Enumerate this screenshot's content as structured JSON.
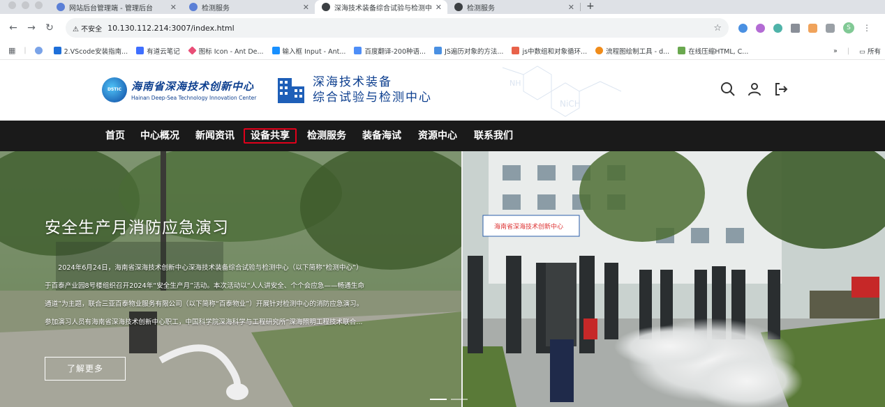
{
  "browser": {
    "tabs": [
      {
        "title": "网站后台管理端 - 管理后台",
        "active": false,
        "color": "#5b7fd6"
      },
      {
        "title": "检测服务",
        "active": false,
        "color": "#5b7fd6"
      },
      {
        "title": "深海技术装备综合试验与检测中",
        "active": true,
        "color": "#3c4043"
      },
      {
        "title": "检测服务",
        "active": false,
        "color": "#3c4043"
      }
    ],
    "close_glyph": "✕",
    "new_tab_glyph": "+",
    "security_label": "不安全",
    "url": "10.130.112.214:3007/index.html",
    "profile_initial": "S"
  },
  "bookmarks": {
    "items": [
      {
        "label": "2.VScode安装指南...",
        "color": "#1e6fd9"
      },
      {
        "label": "有道云笔记",
        "color": "#3f6fff"
      },
      {
        "label": "图标 Icon - Ant De...",
        "color": "#e94e77"
      },
      {
        "label": "输入框 Input - Ant...",
        "color": "#1890ff"
      },
      {
        "label": "百度翻译-200种语...",
        "color": "#4e8ef7"
      },
      {
        "label": "JS遍历对象的方法...",
        "color": "#4a90e2"
      },
      {
        "label": "js中数组和对象循环...",
        "color": "#e8624a"
      },
      {
        "label": "流程图绘制工具 - d...",
        "color": "#f08c1a"
      },
      {
        "label": "在线压缩HTML, C...",
        "color": "#6aa84f"
      }
    ],
    "overflow": "»",
    "all_label": "所有"
  },
  "site": {
    "logo_center_cn": "海南省深海技术创新中心",
    "logo_center_en": "Hainan Deep-Sea Technology Innovation Center",
    "logo_badge": "DSTIC",
    "logo2_line1": "深海技术装备",
    "logo2_line2": "综合试验与检测中心",
    "brand_color": "#0d3f8f"
  },
  "nav": {
    "items": [
      "首页",
      "中心概况",
      "新闻资讯",
      "设备共享",
      "检测服务",
      "装备海试",
      "资源中心",
      "联系我们"
    ],
    "highlighted_index": 3,
    "highlight_color": "#e0001a"
  },
  "hero": {
    "title": "安全生产月消防应急演习",
    "body_lines": [
      "　　2024年6月24日，海南省深海技术创新中心深海技术装备综合试验与检测中心（以下简称“检测中心”）",
      "于百泰产业园8号楼组织召开2024年“安全生产月”活动。本次活动以“人人讲安全、个个会应急——畅通生命",
      "通道”为主题，联合三亚百泰物业服务有限公司（以下简称“百泰物业”）开展针对检测中心的消防应急演习。",
      "参加演习人员有海南省深海技术创新中心职工，中国科学院深海科学与工程研究所“深海照明工程技术联合..."
    ],
    "button_label": "了解更多",
    "banner_sign": "海南省深海技术创新中心",
    "slide_count": 2,
    "active_slide": 0
  }
}
